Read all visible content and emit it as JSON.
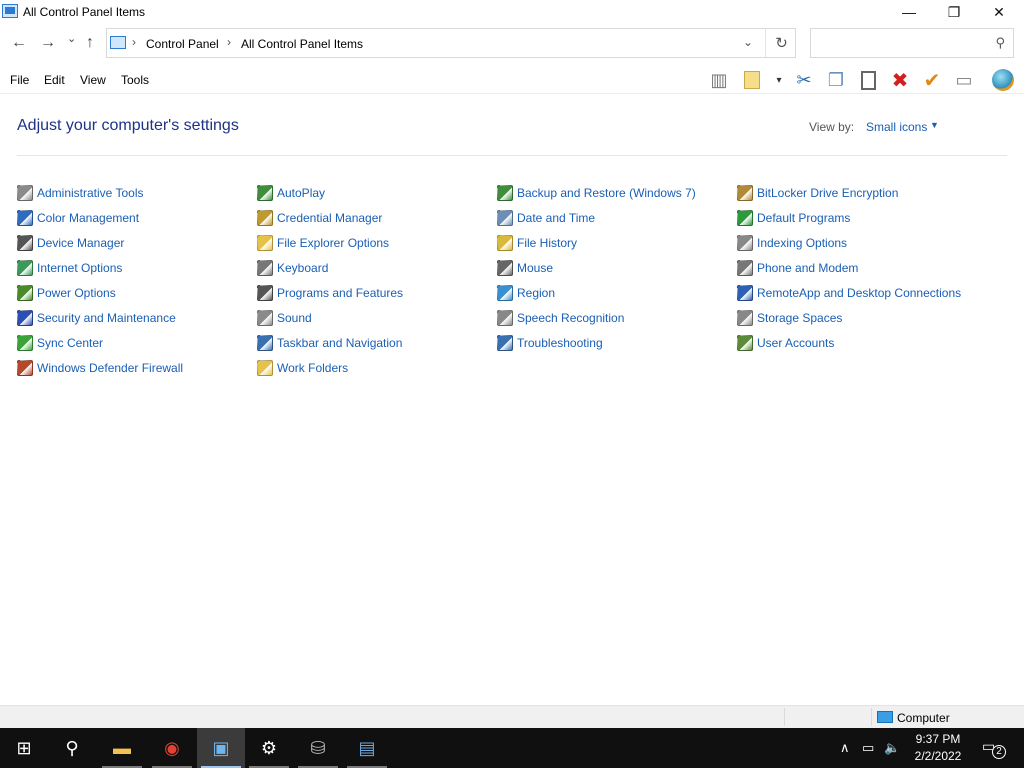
{
  "window": {
    "title": "All Control Panel Items",
    "minimize_glyph": "—",
    "maximize_glyph": "❐",
    "close_glyph": "✕"
  },
  "nav": {
    "back_glyph": "←",
    "forward_glyph": "→",
    "recent_glyph": "⌄",
    "up_glyph": "↑",
    "separator_glyph": "›",
    "breadcrumbs": [
      "Control Panel",
      "All Control Panel Items"
    ],
    "dropdown_glyph": "⌄",
    "refresh_glyph": "↻",
    "search_placeholder": "",
    "search_glyph": "⚲"
  },
  "menu": {
    "items": [
      "File",
      "Edit",
      "View",
      "Tools"
    ]
  },
  "toolbar": {
    "icons": [
      "preview-pane-icon",
      "new-folder-icon",
      "cut-icon",
      "copy-icon",
      "paste-icon",
      "delete-icon",
      "properties-check-icon",
      "rename-icon",
      "shell-globe-icon"
    ],
    "glyphs": [
      "▥",
      "▾",
      "✂",
      "❐",
      "📋",
      "✖",
      "✔",
      "▭",
      "●"
    ],
    "colors": {
      "delete": "#d21f1f",
      "check": "#e0891b",
      "cut": "#2a6fb0"
    }
  },
  "content": {
    "heading": "Adjust your computer's settings",
    "view_by_label": "View by:",
    "view_by_value": "Small icons",
    "view_by_caret": "▼",
    "columns": [
      [
        {
          "label": "Administrative Tools",
          "icon": "administrative-tools-icon",
          "color": "#8a8a8a"
        },
        {
          "label": "Color Management",
          "icon": "color-management-icon",
          "color": "#2d6cc0"
        },
        {
          "label": "Device Manager",
          "icon": "device-manager-icon",
          "color": "#555555"
        },
        {
          "label": "Internet Options",
          "icon": "internet-options-icon",
          "color": "#3a9a5a"
        },
        {
          "label": "Power Options",
          "icon": "power-options-icon",
          "color": "#4a8a2a"
        },
        {
          "label": "Security and Maintenance",
          "icon": "security-flag-icon",
          "color": "#2c4fb3"
        },
        {
          "label": "Sync Center",
          "icon": "sync-center-icon",
          "color": "#3aa33a"
        },
        {
          "label": "Windows Defender Firewall",
          "icon": "firewall-icon",
          "color": "#b8472a"
        }
      ],
      [
        {
          "label": "AutoPlay",
          "icon": "autoplay-icon",
          "color": "#3e8e3e"
        },
        {
          "label": "Credential Manager",
          "icon": "credential-manager-icon",
          "color": "#c09a2a"
        },
        {
          "label": "File Explorer Options",
          "icon": "file-explorer-options-icon",
          "color": "#e6c24a"
        },
        {
          "label": "Keyboard",
          "icon": "keyboard-icon",
          "color": "#777777"
        },
        {
          "label": "Programs and Features",
          "icon": "programs-features-icon",
          "color": "#555555"
        },
        {
          "label": "Sound",
          "icon": "sound-icon",
          "color": "#8a8a8a"
        },
        {
          "label": "Taskbar and Navigation",
          "icon": "taskbar-navigation-icon",
          "color": "#3a6fb0"
        },
        {
          "label": "Work Folders",
          "icon": "work-folders-icon",
          "color": "#e6c24a"
        }
      ],
      [
        {
          "label": "Backup and Restore (Windows 7)",
          "icon": "backup-restore-icon",
          "color": "#3e8e3e"
        },
        {
          "label": "Date and Time",
          "icon": "date-time-icon",
          "color": "#6a8fb8"
        },
        {
          "label": "File History",
          "icon": "file-history-icon",
          "color": "#d9b83a"
        },
        {
          "label": "Mouse",
          "icon": "mouse-icon",
          "color": "#666666"
        },
        {
          "label": "Region",
          "icon": "region-globe-icon",
          "color": "#3a8fd0"
        },
        {
          "label": "Speech Recognition",
          "icon": "microphone-icon",
          "color": "#888888"
        },
        {
          "label": "Troubleshooting",
          "icon": "troubleshooting-icon",
          "color": "#3a6fb0"
        }
      ],
      [
        {
          "label": "BitLocker Drive Encryption",
          "icon": "bitlocker-icon",
          "color": "#b08a3a"
        },
        {
          "label": "Default Programs",
          "icon": "default-programs-icon",
          "color": "#2a9a3a"
        },
        {
          "label": "Indexing Options",
          "icon": "indexing-options-icon",
          "color": "#888888"
        },
        {
          "label": "Phone and Modem",
          "icon": "phone-modem-icon",
          "color": "#777777"
        },
        {
          "label": "RemoteApp and Desktop Connections",
          "icon": "remoteapp-icon",
          "color": "#2d5fb3"
        },
        {
          "label": "Storage Spaces",
          "icon": "storage-spaces-icon",
          "color": "#888888"
        },
        {
          "label": "User Accounts",
          "icon": "user-accounts-icon",
          "color": "#5a8a3a"
        }
      ]
    ]
  },
  "statusbar": {
    "location": "Computer"
  },
  "taskbar": {
    "apps": [
      {
        "name": "start-icon",
        "glyph": "⊞",
        "color": "#ffffff",
        "active": false
      },
      {
        "name": "search-icon",
        "glyph": "⚲",
        "color": "#ffffff",
        "active": false
      },
      {
        "name": "file-explorer-icon",
        "glyph": "▬",
        "color": "#f2c14e",
        "active": false
      },
      {
        "name": "chrome-icon",
        "glyph": "◉",
        "color": "#e34133",
        "active": false
      },
      {
        "name": "control-panel-icon",
        "glyph": "▣",
        "color": "#6fb6f0",
        "active": true
      },
      {
        "name": "settings-icon",
        "glyph": "⚙",
        "color": "#ffffff",
        "active": false
      },
      {
        "name": "network-share-icon",
        "glyph": "⛁",
        "color": "#bbbbbb",
        "active": false
      },
      {
        "name": "remote-desktop-icon",
        "glyph": "▤",
        "color": "#6fa8dc",
        "active": false
      }
    ],
    "tray": {
      "chevron_glyph": "∧",
      "network_glyph": "▭",
      "volume_glyph": "🔈",
      "time": "9:37 PM",
      "date": "2/2/2022",
      "notifications_glyph": "▭",
      "notifications_count": "2"
    }
  }
}
